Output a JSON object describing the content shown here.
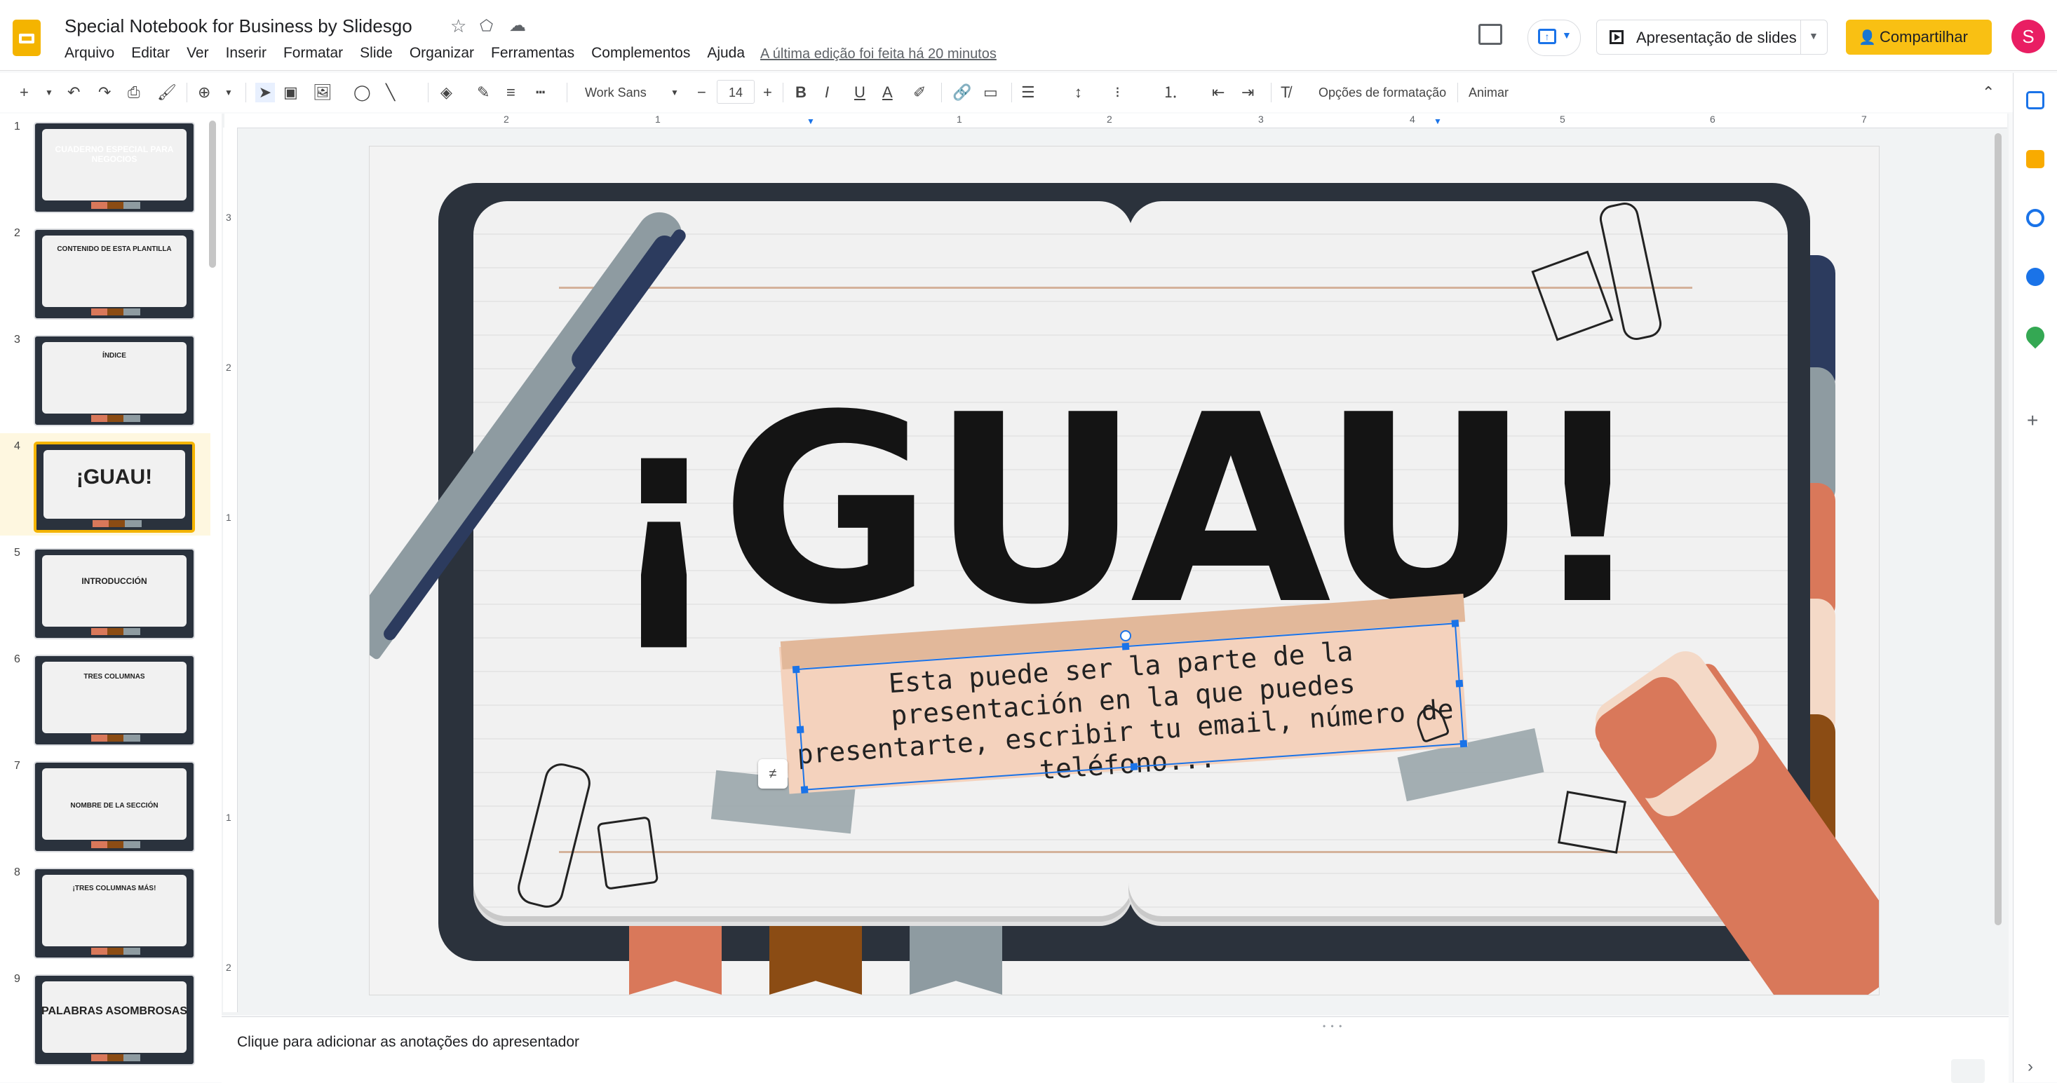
{
  "header": {
    "doc_title": "Special Notebook for Business by Slidesgo",
    "menu": [
      "Arquivo",
      "Editar",
      "Ver",
      "Inserir",
      "Formatar",
      "Slide",
      "Organizar",
      "Ferramentas",
      "Complementos",
      "Ajuda"
    ],
    "last_edit": "A última edição foi feita há 20 minutos",
    "slideshow_label": "Apresentação de slides",
    "share_label": "Compartilhar",
    "avatar_initial": "S",
    "icons": [
      "star-icon",
      "move-to-drive-icon",
      "cloud-saved-icon",
      "comments-icon",
      "present-mode-icon"
    ]
  },
  "toolbar": {
    "font_name": "Work Sans",
    "font_size": "14",
    "format_options": "Opções de formatação",
    "animate": "Animar"
  },
  "rulers": {
    "top_numbers": [
      "2",
      "1",
      "1",
      "2",
      "3",
      "4",
      "5",
      "6",
      "7"
    ],
    "left_numbers": [
      "3",
      "2",
      "1",
      "1",
      "2"
    ]
  },
  "filmstrip": {
    "slides": [
      {
        "num": "1",
        "label": "CUADERNO ESPECIAL PARA NEGOCIOS"
      },
      {
        "num": "2",
        "label": "CONTENIDO DE ESTA PLANTILLA"
      },
      {
        "num": "3",
        "label": "ÍNDICE"
      },
      {
        "num": "4",
        "label": "¡GUAU!"
      },
      {
        "num": "5",
        "label": "INTRODUCCIÓN"
      },
      {
        "num": "6",
        "label": "TRES COLUMNAS"
      },
      {
        "num": "7",
        "label": "NOMBRE DE LA SECCIÓN"
      },
      {
        "num": "8",
        "label": "¡TRES COLUMNAS MÁS!"
      },
      {
        "num": "9",
        "label": "PALABRAS ASOMBROSAS"
      }
    ],
    "active_slide": 4
  },
  "slide": {
    "headline": "¡GUAU!",
    "body_text": "Esta puede ser la parte de la presentación en la que puedes presentarte, escribir tu email, número de teléfono..."
  },
  "notes": {
    "placeholder": "Clique para adicionar as anotações do apresentador"
  },
  "colors": {
    "navy": "#2c3b5e",
    "gray": "#8e9ba1",
    "coral": "#d9785a",
    "peach": "#f4d9c7",
    "brown": "#8b4c14",
    "share_button": "#f9c013",
    "selection": "#1a73e8"
  }
}
